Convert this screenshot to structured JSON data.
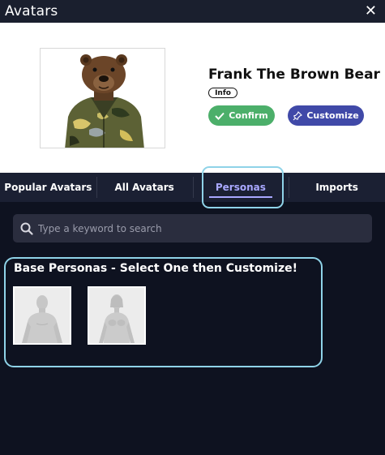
{
  "window": {
    "title": "Avatars",
    "close_icon": "close-icon"
  },
  "preview": {
    "avatar_name": "Frank The Brown Bear",
    "info_label": "Info",
    "confirm_label": "Confirm",
    "customize_label": "Customize",
    "colors": {
      "confirm": "#4caf6a",
      "customize": "#4049a8"
    }
  },
  "tabs": [
    {
      "label": "Popular Avatars",
      "active": false
    },
    {
      "label": "All Avatars",
      "active": false
    },
    {
      "label": "Personas",
      "active": true
    },
    {
      "label": "Imports",
      "active": false
    }
  ],
  "search": {
    "placeholder": "Type a keyword to search",
    "value": "",
    "icon": "search-icon"
  },
  "base_personas": {
    "title": "Base Personas - Select One then Customize!",
    "items": [
      {
        "icon": "male-persona-icon"
      },
      {
        "icon": "female-persona-icon"
      }
    ]
  },
  "colors": {
    "accent": "#a9a8ff",
    "highlight": "#8fd3e8",
    "background": "#0e1220"
  }
}
